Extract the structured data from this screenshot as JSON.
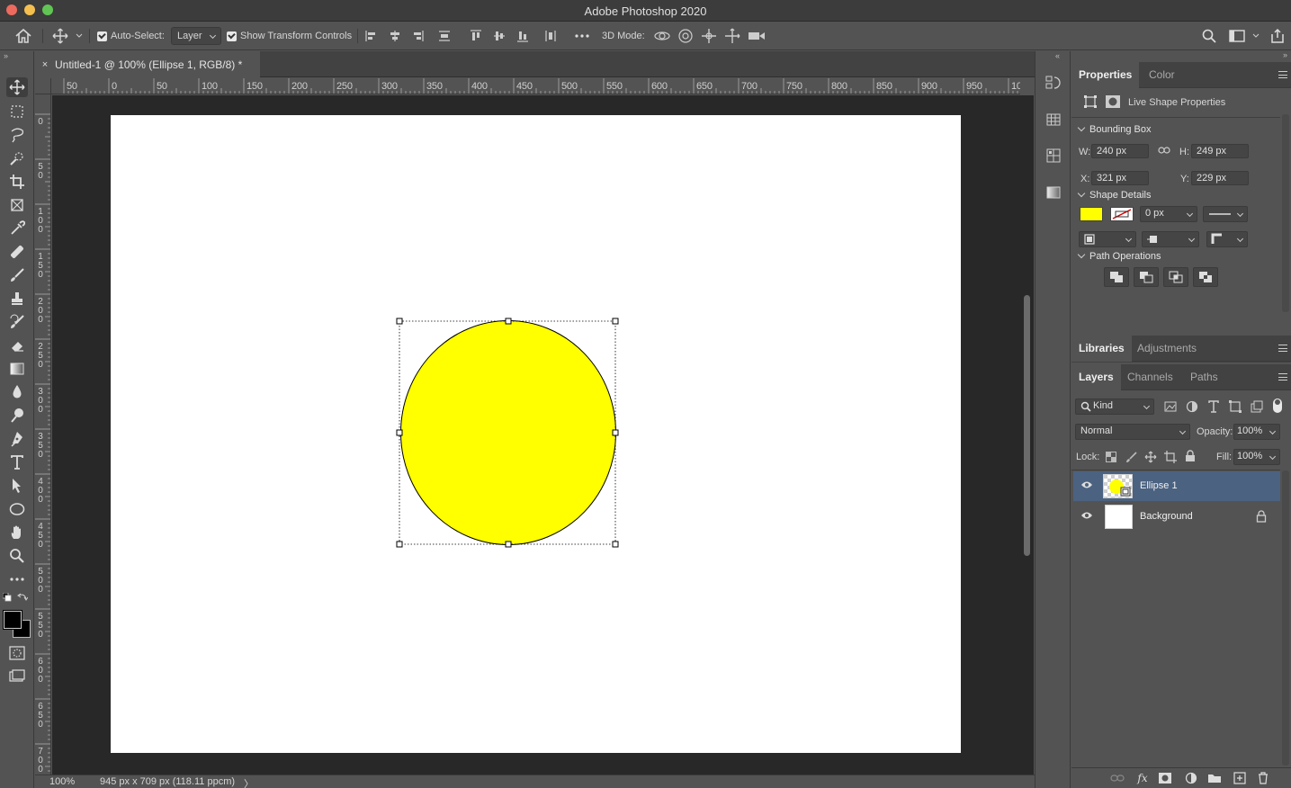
{
  "window": {
    "title": "Adobe Photoshop 2020"
  },
  "options": {
    "auto_select_label": "Auto-Select:",
    "auto_select_value": "Layer",
    "show_transform_label": "Show Transform Controls",
    "three_d_mode_label": "3D Mode:"
  },
  "document": {
    "tab_title": "Untitled-1 @ 100% (Ellipse 1, RGB/8) *",
    "close_glyph": "×",
    "zoom": "100%",
    "dimensions": "945 px x 709 px (118.11 ppcm)",
    "status_arrow": "〉"
  },
  "rulers": {
    "h_labels": [
      "50",
      "0",
      "50",
      "100",
      "150",
      "200",
      "250",
      "300",
      "350",
      "400",
      "450",
      "500",
      "550",
      "600",
      "650",
      "700",
      "750",
      "800",
      "850",
      "900",
      "950",
      "10"
    ],
    "v_labels": [
      "0",
      "50",
      "100",
      "150",
      "200",
      "250",
      "300",
      "350",
      "400",
      "450",
      "500",
      "550",
      "600",
      "650",
      "700"
    ]
  },
  "shape": {
    "fill_color": "#ffff00",
    "stroke_color": "#000000"
  },
  "properties_panel": {
    "tabs": [
      "Properties",
      "Color"
    ],
    "header": "Live Shape Properties",
    "bounding_box_label": "Bounding Box",
    "w_label": "W:",
    "w_value": "240 px",
    "h_label": "H:",
    "h_value": "249 px",
    "x_label": "X:",
    "x_value": "321 px",
    "y_label": "Y:",
    "y_value": "229 px",
    "shape_details_label": "Shape Details",
    "fill_swatch": "#ffff00",
    "stroke_width": "0 px",
    "path_operations_label": "Path Operations"
  },
  "libraries_panel": {
    "tabs": [
      "Libraries",
      "Adjustments"
    ]
  },
  "layers_panel": {
    "tabs": [
      "Layers",
      "Channels",
      "Paths"
    ],
    "filter_kind": "Kind",
    "blend_mode": "Normal",
    "opacity_label": "Opacity:",
    "opacity_value": "100%",
    "lock_label": "Lock:",
    "fill_label": "Fill:",
    "fill_value": "100%",
    "layers": [
      {
        "name": "Ellipse 1",
        "selected": true,
        "locked": false
      },
      {
        "name": "Background",
        "selected": false,
        "locked": true
      }
    ]
  }
}
